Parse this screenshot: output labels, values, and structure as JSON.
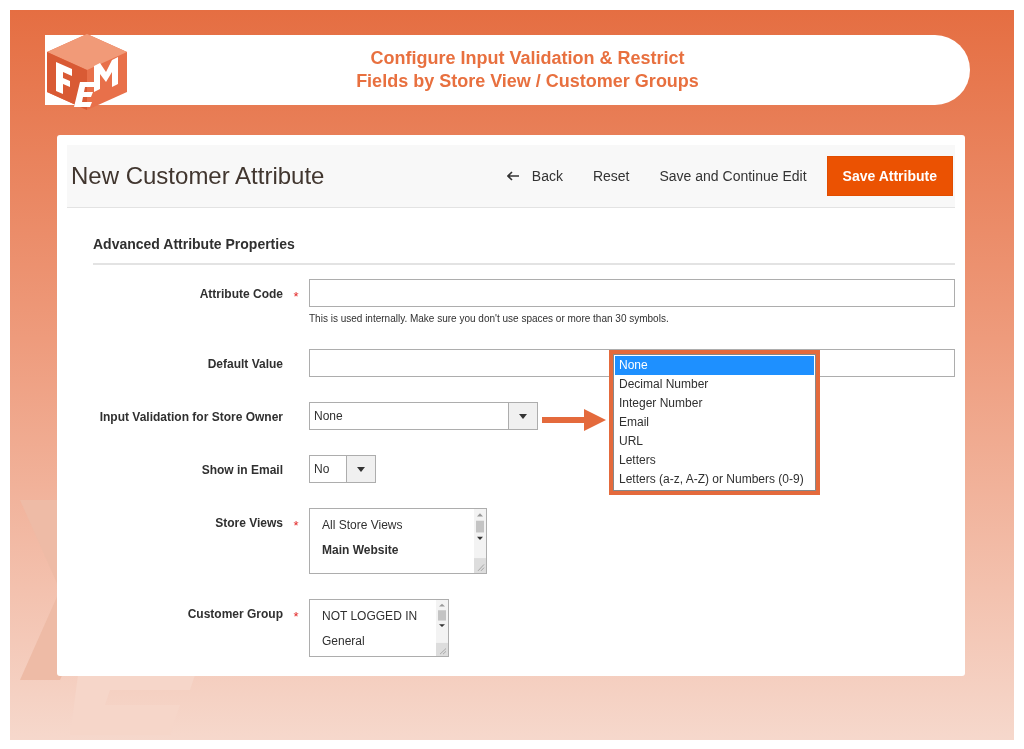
{
  "banner": {
    "title_lines": [
      "Configure Input Validation & Restrict",
      "Fields by Store View / Customer Groups"
    ]
  },
  "page": {
    "title": "New Customer Attribute",
    "actions": [
      {
        "label": "Back",
        "kind": "back"
      },
      {
        "label": "Reset",
        "kind": "plain"
      },
      {
        "label": "Save and Continue Edit",
        "kind": "plain"
      },
      {
        "label": "Save Attribute",
        "kind": "primary"
      }
    ]
  },
  "section": {
    "title": "Advanced Attribute Properties"
  },
  "fields": [
    {
      "label": "Attribute Code",
      "required_mark": "*",
      "kind": "text",
      "note": "This is used internally. Make sure you don't use spaces or more than 30 symbols."
    },
    {
      "label": "Default Value",
      "kind": "text"
    },
    {
      "label": "Input Validation for Store Owner",
      "kind": "select",
      "value": "None"
    },
    {
      "label": "Show in Email",
      "kind": "select",
      "value": "No"
    },
    {
      "label": "Store Views",
      "required_mark": "*",
      "kind": "multiselect",
      "options": [
        {
          "label": "All Store Views",
          "bold": false
        },
        {
          "label": "Main Website",
          "bold": true
        }
      ]
    },
    {
      "label": "Customer Group",
      "required_mark": "*",
      "kind": "multiselect",
      "options": [
        {
          "label": "NOT LOGGED IN",
          "bold": false
        },
        {
          "label": "General",
          "bold": false
        }
      ]
    }
  ],
  "dropdown": {
    "options": [
      {
        "label": "None",
        "selected": true
      },
      {
        "label": "Decimal Number",
        "selected": false
      },
      {
        "label": "Integer Number",
        "selected": false
      },
      {
        "label": "Email",
        "selected": false
      },
      {
        "label": "URL",
        "selected": false
      },
      {
        "label": "Letters",
        "selected": false
      },
      {
        "label": "Letters (a-z, A-Z) or Numbers (0-9)",
        "selected": false
      }
    ]
  }
}
